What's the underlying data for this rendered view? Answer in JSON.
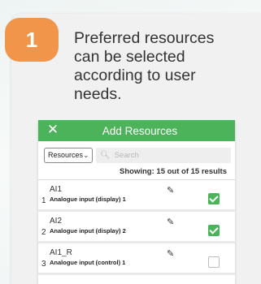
{
  "step": {
    "number": "1",
    "color": "#f0954a"
  },
  "caption": "Preferred resources can be selected according to user needs.",
  "dialog": {
    "close_icon": "close-icon",
    "title": "Add Resources",
    "header_color": "#4cb35a",
    "filter": {
      "selected": "Resources"
    },
    "search": {
      "placeholder": "Search"
    },
    "showing": "Showing: 15 out of 15 results",
    "rows": [
      {
        "index": "1",
        "name": "AI1",
        "description": "Analogue input (display) 1",
        "checked": true
      },
      {
        "index": "2",
        "name": "AI2",
        "description": "Analogue input (display) 2",
        "checked": true
      },
      {
        "index": "3",
        "name": "AI1_R",
        "description": "Analogue input (control) 1",
        "checked": false
      }
    ]
  }
}
